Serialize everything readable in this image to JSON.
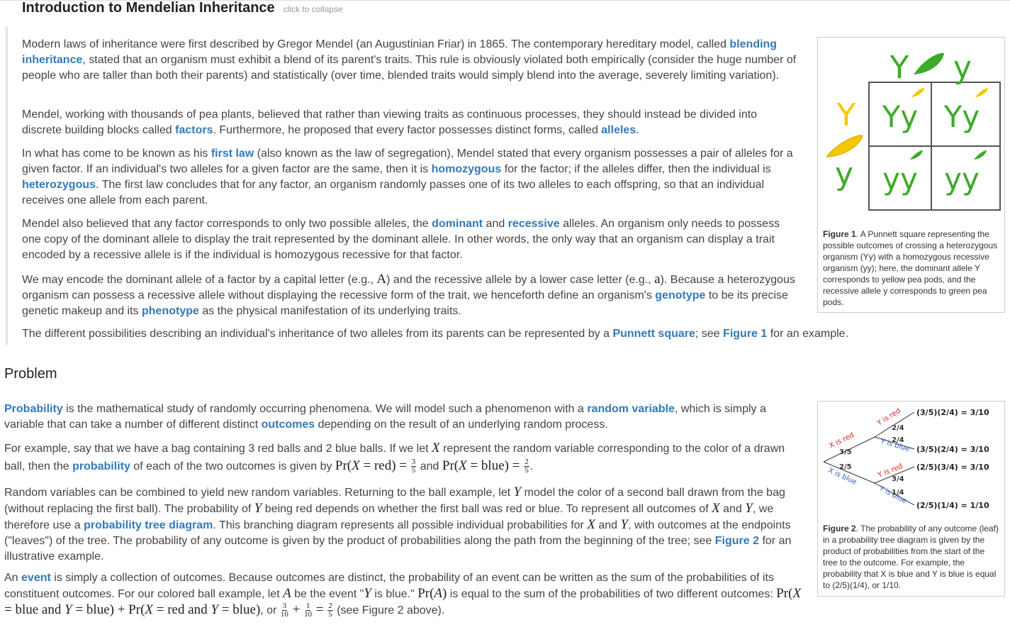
{
  "intro": {
    "title": "Introduction to Mendelian Inheritance",
    "collapse": "click to collapse",
    "p1": {
      "a": "Modern laws of inheritance were first described by Gregor Mendel (an Augustinian Friar) in 1865. The contemporary hereditary model, called ",
      "t1": "blending inheritance",
      "b": ", stated that an organism must exhibit a blend of its parent's traits. This rule is obviously violated both empirically (consider the huge number of people who are taller than both their parents) and statistically (over time, blended traits would simply blend into the average, severely limiting variation)."
    },
    "p2": {
      "a": "Mendel, working with thousands of pea plants, believed that rather than viewing traits as continuous processes, they should instead be divided into discrete building blocks called ",
      "t1": "factors",
      "b": ". Furthermore, he proposed that every factor possesses distinct forms, called ",
      "t2": "alleles",
      "c": "."
    },
    "p3": {
      "a": "In what has come to be known as his ",
      "t1": "first law",
      "b": " (also known as the law of segregation), Mendel stated that every organism possesses a pair of alleles for a given factor. If an individual's two alleles for a given factor are the same, then it is ",
      "t2": "homozygous",
      "c": " for the factor; if the alleles differ, then the individual is ",
      "t3": "heterozygous",
      "d": ". The first law concludes that for any factor, an organism randomly passes one of its two alleles to each offspring, so that an individual receives one allele from each parent."
    },
    "p4": {
      "a": "Mendel also believed that any factor corresponds to only two possible alleles, the ",
      "t1": "dominant",
      "b": " and ",
      "t2": "recessive",
      "c": " alleles. An organism only needs to possess one copy of the dominant allele to display the trait represented by the dominant allele. In other words, the only way that an organism can display a trait encoded by a recessive allele is if the individual is homozygous recessive for that factor."
    },
    "p5": {
      "a": "We may encode the dominant allele of a factor by a capital letter (e.g., ",
      "m1": "A",
      "b": ") and the recessive allele by a lower case letter (e.g., ",
      "m2": "a",
      "c": "). Because a heterozygous organism can possess a recessive allele without displaying the recessive form of the trait, we henceforth define an organism's ",
      "t1": "genotype",
      "d": " to be its precise genetic makeup and its ",
      "t2": "phenotype",
      "e": " as the physical manifestation of its underlying traits."
    },
    "p6": {
      "a": "The different possibilities describing an individual's inheritance of two alleles from its parents can be represented by a ",
      "t1": "Punnett square",
      "b": "; see ",
      "t2": "Figure 1",
      "c": " for an example."
    }
  },
  "figure1": {
    "col_labels": [
      "Y",
      "y"
    ],
    "row_labels": [
      "Y",
      "y"
    ],
    "cells": [
      "Yy",
      "Yy",
      "yy",
      "yy"
    ],
    "caption_bold": "Figure 1",
    "caption": ". A Punnett square representing the possible outcomes of crossing a heterozygous organism (Yy) with a homozygous recessive organism (yy); here, the dominant allele Y corresponds to yellow pea pods, and the recessive allele y corresponds to green pea pods.",
    "colors": {
      "yellow": "#f6c600",
      "green": "#3cab28",
      "grid": "#555555"
    }
  },
  "problem": {
    "title": "Problem",
    "p1": {
      "t1": "Probability",
      "a": " is the mathematical study of randomly occurring phenomena. We will model such a phenomenon with a ",
      "t2": "random variable",
      "b": ", which is simply a variable that can take a number of different distinct ",
      "t3": "outcomes",
      "c": " depending on the result of an underlying random process."
    },
    "p2": {
      "a": "For example, say that we have a bag containing 3 red balls and 2 blue balls. If we let ",
      "m1": "X",
      "b": " represent the random variable corresponding to the color of a drawn ball, then the ",
      "t1": "probability",
      "c": " of each of the two outcomes is given by ",
      "m2": "Pr(",
      "m3": "X",
      "m4": " = red) = ",
      "f1n": "3",
      "f1d": "5",
      "d": " and ",
      "m5": "Pr(",
      "m6": "X",
      "m7": " = blue) = ",
      "f2n": "2",
      "f2d": "5",
      "e": "."
    },
    "p3": {
      "a": "Random variables can be combined to yield new random variables. Returning to the ball example, let ",
      "m1": "Y",
      "b": " model the color of a second ball drawn from the bag (without replacing the first ball). The probability of ",
      "m2": "Y",
      "c": " being red depends on whether the first ball was red or blue. To represent all outcomes of ",
      "m3": "X",
      "d": " and ",
      "m4": "Y",
      "e": ", we therefore use a ",
      "t1": "probability tree diagram",
      "f": ". This branching diagram represents all possible individual probabilities for ",
      "m5": "X",
      "g": " and ",
      "m6": "Y",
      "h": ", with outcomes at the endpoints (\"leaves\") of the tree. The probability of any outcome is given by the product of probabilities along the path from the beginning of the tree; see ",
      "t2": "Figure 2",
      "i": " for an illustrative example."
    },
    "p4": {
      "a": "An ",
      "t1": "event",
      "b": " is simply a collection of outcomes. Because outcomes are distinct, the probability of an event can be written as the sum of the probabilities of its constituent outcomes. For our colored ball example, let ",
      "m1": "A",
      "c": " be the event \"",
      "m2": "Y",
      "d": " is blue.\" ",
      "m3": "Pr(",
      "m4": "A",
      "m5": ")",
      "e": " is equal to the sum of the probabilities of two different outcomes: ",
      "m6": "Pr(",
      "m7": "X",
      "m8": " = blue and ",
      "m9": "Y",
      "m10": " = blue) + Pr(",
      "m11": "X",
      "m12": " = red and ",
      "m13": "Y",
      "m14": " = blue)",
      "f": ", or ",
      "f1n": "3",
      "f1d": "10",
      "plus": " + ",
      "f2n": "1",
      "f2d": "10",
      "eq": " = ",
      "f3n": "2",
      "f3d": "5",
      "g": " (see Figure 2 above)."
    }
  },
  "figure2": {
    "branch1_top": "X is red",
    "branch1_top_p": "3/5",
    "branch1_bot": "X is blue",
    "branch1_bot_p": "2/5",
    "b2a_top": "Y is red",
    "b2a_top_p": "2/4",
    "b2a_bot": "Y is blue",
    "b2a_bot_p": "2/4",
    "b2b_top": "Y is red",
    "b2b_top_p": "3/4",
    "b2b_bot": "Y is blue",
    "b2b_bot_p": "1/4",
    "leaves": [
      "(3/5)(2/4) = 3/10",
      "(3/5)(2/4) = 3/10",
      "(2/5)(3/4) = 3/10",
      "(2/5)(1/4) = 1/10"
    ],
    "caption_bold": "Figure 2",
    "caption": ". The probability of any outcome (leaf) in a probability tree diagram is given by the product of probabilities from the start of the tree to the outcome. For example, the probability that X is blue and Y is blue is equal to (2/5)(1/4), or 1/10.",
    "colors": {
      "red": "#e02020",
      "blue": "#2a5ad6"
    }
  }
}
